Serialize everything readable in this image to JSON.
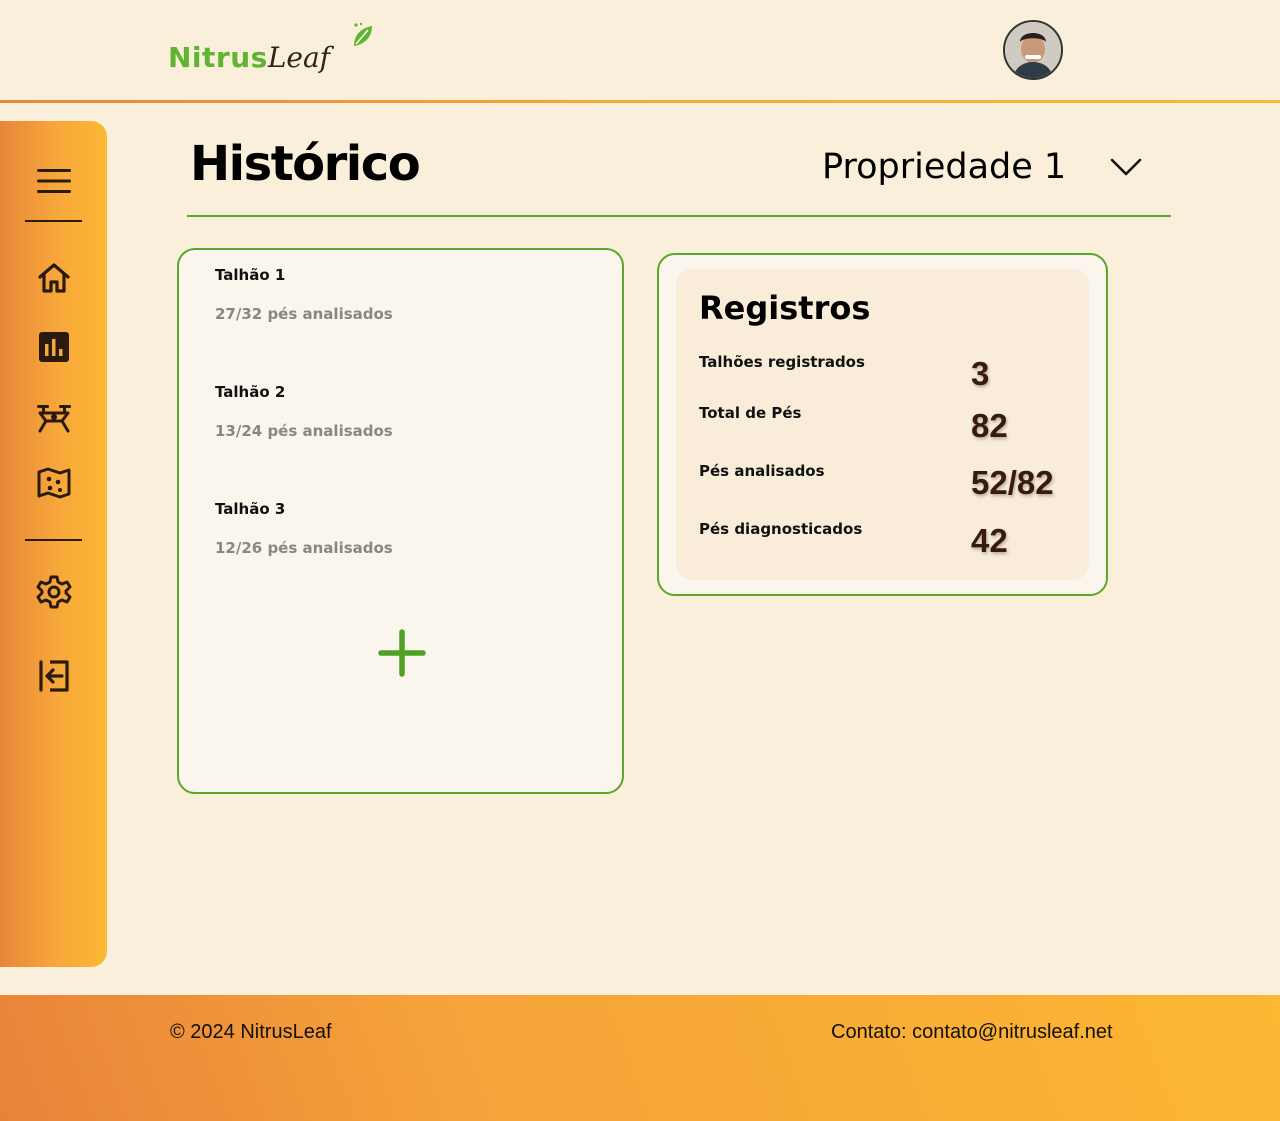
{
  "header": {
    "logo_part1": "Nitrus",
    "logo_part2": "Leaf",
    "avatar_icon": "user-avatar"
  },
  "sidebar": {
    "items": [
      {
        "icon": "menu-icon"
      },
      {
        "icon": "home-icon"
      },
      {
        "icon": "bar-chart-icon"
      },
      {
        "icon": "drone-icon"
      },
      {
        "icon": "map-icon"
      },
      {
        "icon": "settings-icon"
      },
      {
        "icon": "logout-icon"
      }
    ]
  },
  "page": {
    "title": "Histórico",
    "property_selected": "Propriedade 1"
  },
  "talhoes": [
    {
      "name": "Talhão 1",
      "count": "27/32 pés analisados"
    },
    {
      "name": "Talhão 2",
      "count": "13/24 pés analisados"
    },
    {
      "name": "Talhão 3",
      "count": "12/26 pés analisados"
    }
  ],
  "registros": {
    "title": "Registros",
    "rows": [
      {
        "label": "Talhões registrados",
        "value": "3"
      },
      {
        "label": "Total de Pés",
        "value": "82"
      },
      {
        "label": "Pés analisados",
        "value": "52/82"
      },
      {
        "label": "Pés diagnosticados",
        "value": "42"
      }
    ]
  },
  "footer": {
    "copyright": "© 2024 NitrusLeaf",
    "contact": "Contato: contato@nitrusleaf.net"
  },
  "colors": {
    "accent_green": "#5ba62d",
    "accent_orange": "#fdb733",
    "background": "#faefda"
  }
}
